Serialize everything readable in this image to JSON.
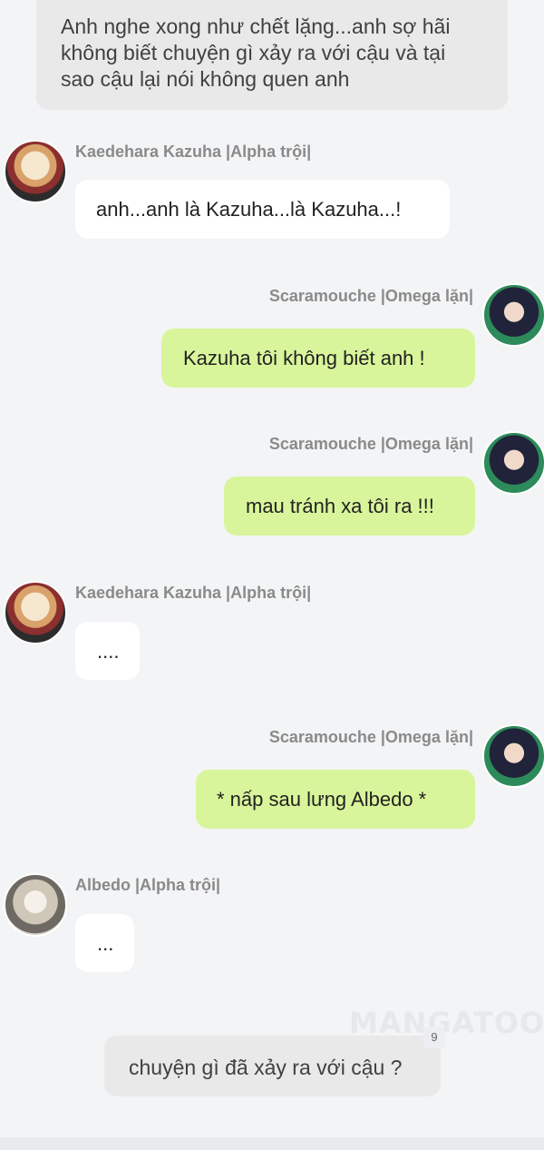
{
  "narration_top": "Anh nghe xong như chết lặng...anh sợ hãi không biết chuyện gì xảy ra với cậu và tại sao cậu lại nói không quen anh",
  "messages": [
    {
      "sender": "Kaedehara Kazuha |Alpha trội|",
      "text": "anh...anh là Kazuha...là Kazuha...!",
      "side": "left",
      "avatar": "kazuha-avatar"
    },
    {
      "sender": "Scaramouche |Omega lặn|",
      "text": "Kazuha tôi không biết anh !",
      "side": "right",
      "avatar": "scaramouche-avatar"
    },
    {
      "sender": "Scaramouche |Omega lặn|",
      "text": "mau tránh xa tôi ra !!!",
      "side": "right",
      "avatar": "scaramouche-avatar"
    },
    {
      "sender": "Kaedehara Kazuha |Alpha trội|",
      "text": "....",
      "side": "left",
      "avatar": "kazuha-avatar"
    },
    {
      "sender": "Scaramouche |Omega lặn|",
      "text": "* nấp sau lưng Albedo *",
      "side": "right",
      "avatar": "scaramouche-avatar"
    },
    {
      "sender": "Albedo |Alpha trội|",
      "text": "...",
      "side": "left",
      "avatar": "albedo-avatar"
    }
  ],
  "narration_bottom": "chuyện gì đã xảy ra với cậu ?",
  "comment_count": "9",
  "watermark": "MANGATOON",
  "colors": {
    "background": "#f3f4f6",
    "bubble_left": "#ffffff",
    "bubble_right": "#d9f59b",
    "narration": "#e9e9ea"
  }
}
